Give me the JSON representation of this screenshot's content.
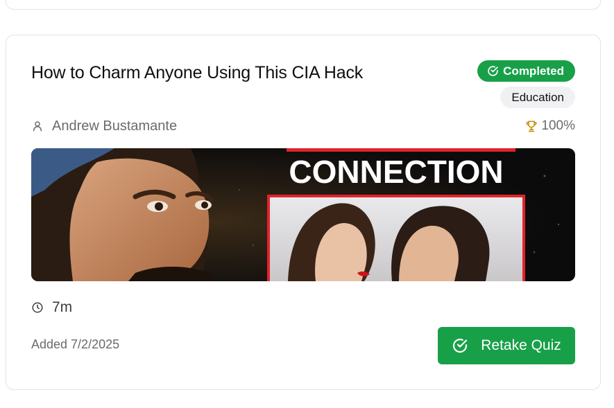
{
  "card": {
    "title": "How to Charm Anyone Using This CIA Hack",
    "status_badge": "Completed",
    "category_badge": "Education",
    "author": "Andrew Bustamante",
    "score": "100%",
    "thumbnail": {
      "headline": "CONNECTION",
      "alt_icon": "video-thumbnail"
    },
    "duration": "7m",
    "added": "Added 7/2/2025",
    "retake_label": "Retake Quiz"
  },
  "colors": {
    "accent_green": "#18a049",
    "badge_gray": "#f1f1f3",
    "trophy_gold": "#c8930e",
    "thumbnail_red": "#e0242a"
  }
}
